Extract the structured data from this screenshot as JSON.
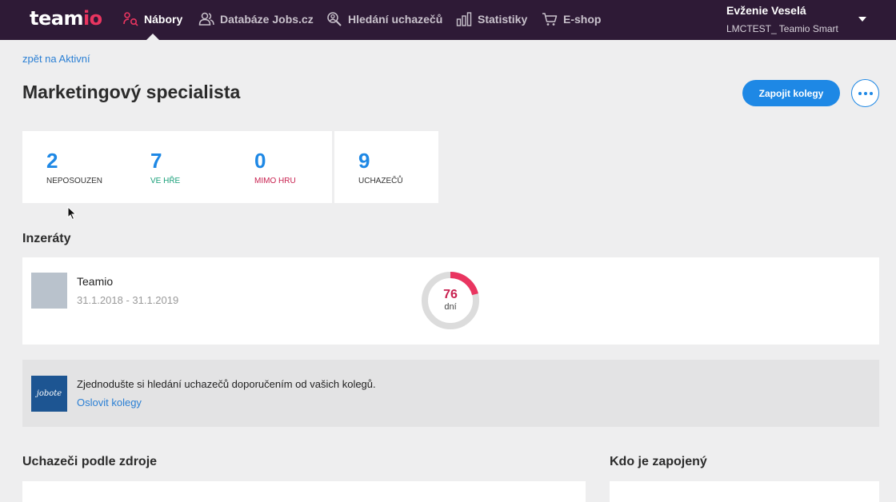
{
  "app": {
    "logo_part1": "team",
    "logo_part2": "io"
  },
  "nav": {
    "items": [
      {
        "label": "Nábory",
        "icon": "recruitment-icon",
        "active": true
      },
      {
        "label": "Databáze Jobs.cz",
        "icon": "people-icon",
        "active": false
      },
      {
        "label": "Hledání uchazečů",
        "icon": "search-people-icon",
        "active": false
      },
      {
        "label": "Statistiky",
        "icon": "bar-chart-icon",
        "active": false
      },
      {
        "label": "E-shop",
        "icon": "cart-icon",
        "active": false
      }
    ],
    "user_name": "Evženie Veselá",
    "user_company": "LMCTEST_ Teamio Smart"
  },
  "page": {
    "back_link": "zpět na Aktivní",
    "title": "Marketingový specialista",
    "primary_button": "Zapojit kolegy",
    "more_button_icon": "ellipsis-icon"
  },
  "stats": [
    {
      "value": "2",
      "label": "NEPOSOUZEN",
      "color": "#1e88e5"
    },
    {
      "value": "7",
      "label": "VE HŘE",
      "color": "#1e88e5",
      "label_color": "#1aa07a"
    },
    {
      "value": "0",
      "label": "MIMO HRU",
      "color": "#1e88e5",
      "label_color": "#c8204f"
    },
    {
      "value": "9",
      "label": "UCHAZEČŮ",
      "color": "#1e88e5"
    }
  ],
  "ads": {
    "section_title": "Inzeráty",
    "items": [
      {
        "name": "Teamio",
        "dates": "31.1.2018 - 31.1.2019",
        "days_value": "76",
        "days_unit": "dní",
        "elapsed_fraction": 0.21
      }
    ]
  },
  "promo": {
    "logo_text": "jobote",
    "text": "Zjednodušte si hledání uchazečů doporučením od vašich kolegů.",
    "link": "Oslovit kolegy"
  },
  "sections": {
    "sources_title": "Uchazeči podle zdroje",
    "involved_title": "Kdo je zapojený"
  },
  "colors": {
    "nav_bg": "#2e1a36",
    "accent": "#1e88e5",
    "brand_red": "#e93560"
  }
}
